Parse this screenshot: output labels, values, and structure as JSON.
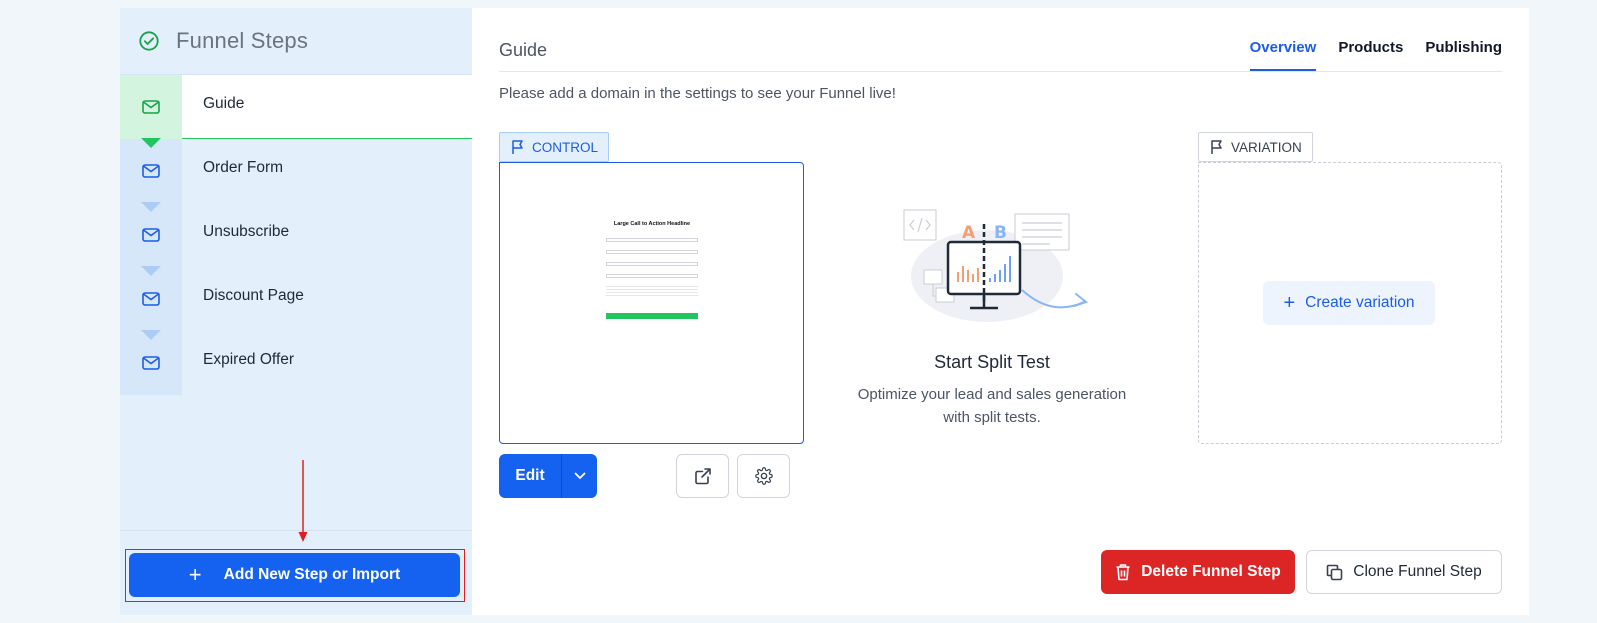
{
  "sidebar": {
    "title": "Funnel Steps",
    "steps": [
      {
        "label": "Guide",
        "active": true
      },
      {
        "label": "Order Form"
      },
      {
        "label": "Unsubscribe"
      },
      {
        "label": "Discount Page"
      },
      {
        "label": "Expired Offer"
      }
    ],
    "add_button": "Add New Step or Import"
  },
  "main": {
    "title": "Guide",
    "tabs": [
      "Overview",
      "Products",
      "Publishing"
    ],
    "active_tab": "Overview",
    "notice": "Please add a domain in the settings to see your Funnel live!",
    "control": {
      "tag": "CONTROL",
      "preview": {
        "headline": "Large Call to Action Headline"
      },
      "edit_label": "Edit"
    },
    "split": {
      "illus_a": "A",
      "illus_b": "B",
      "title": "Start Split Test",
      "desc_line1": "Optimize your lead and sales generation",
      "desc_line2": "with split tests."
    },
    "variation": {
      "tag": "VARIATION",
      "create_label": "Create variation"
    },
    "delete_label": "Delete Funnel Step",
    "clone_label": "Clone Funnel Step"
  },
  "colors": {
    "primary": "#1662f0",
    "danger": "#dc2626",
    "success": "#22c55e",
    "sidebar_bg": "#e3f0fc",
    "annotation": "#e11d24"
  }
}
